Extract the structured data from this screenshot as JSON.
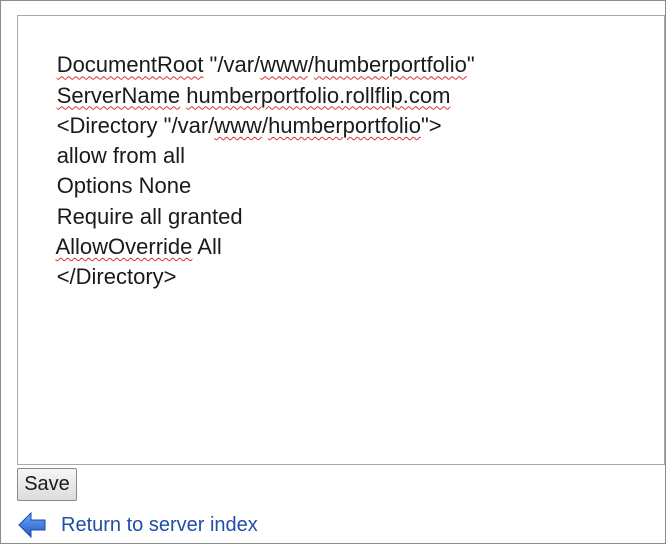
{
  "editor": {
    "lines": [
      [
        {
          "t": "DocumentRoot",
          "sq": true
        },
        {
          "t": " \"/var/",
          "sq": false
        },
        {
          "t": "www",
          "sq": true
        },
        {
          "t": "/",
          "sq": false
        },
        {
          "t": "humberportfolio",
          "sq": true
        },
        {
          "t": "\"",
          "sq": false
        }
      ],
      [
        {
          "t": "ServerName",
          "sq": true
        },
        {
          "t": " ",
          "sq": false
        },
        {
          "t": "humberportfolio.rollflip.com",
          "sq": true
        }
      ],
      [
        {
          "t": "<Directory \"/var/",
          "sq": false
        },
        {
          "t": "www",
          "sq": true
        },
        {
          "t": "/",
          "sq": false
        },
        {
          "t": "humberportfolio",
          "sq": true
        },
        {
          "t": "\">",
          "sq": false
        }
      ],
      [
        {
          "t": "allow from all",
          "sq": false
        }
      ],
      [
        {
          "t": "Options None",
          "sq": false
        }
      ],
      [
        {
          "t": "Require all granted",
          "sq": false
        }
      ],
      [
        {
          "t": "AllowOverride",
          "sq": true
        },
        {
          "t": " All",
          "sq": false
        }
      ],
      [
        {
          "t": "</Directory>",
          "sq": false
        }
      ]
    ]
  },
  "actions": {
    "save_label": "Save"
  },
  "nav": {
    "back_label": "Return to server index",
    "back_icon": "left-arrow-icon"
  },
  "colors": {
    "link": "#1f4fa8",
    "arrow": "#2e6fd6",
    "spell_underline": "#e03030"
  }
}
